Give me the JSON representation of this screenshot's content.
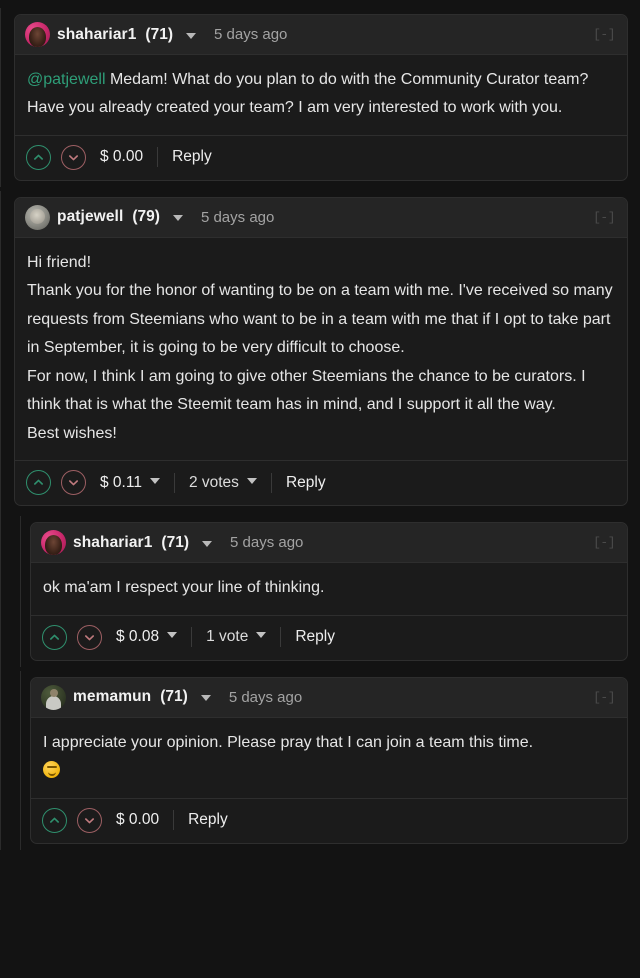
{
  "theme": {
    "page_background": "#131313",
    "card_background": "#1b1b1b",
    "header_background": "#252525",
    "border": "#2e2e2e",
    "upvote_color": "#2f8f6d",
    "downvote_color": "#9d5f63",
    "mention_color": "#2e9e78",
    "text_color": "#e6e6e6",
    "muted_text_color": "#a3a3a3"
  },
  "comments": [
    {
      "id": "comment-shahariar1-root",
      "level": 1,
      "avatar_style": "av-pink",
      "author": "shahariar1",
      "reputation": "(71)",
      "author_caret_icon": "chevron-down-icon",
      "timestamp": "5 days ago",
      "collapse_toggle": "[-]",
      "body_segments": [
        {
          "type": "mention",
          "text": "@patjewell"
        },
        {
          "type": "text",
          "text": " Medam! What do you plan to do with the Community Curator team? Have you already created your team? I am very interested to work with you."
        }
      ],
      "body_plain": "@patjewell Medam! What do you plan to do with the Community Curator team? Have you already created your team? I am very interested to work with you.",
      "upvote_icon": "chevron-up-icon",
      "downvote_icon": "chevron-down-icon",
      "payout": "$ 0.00",
      "payout_currency": "$",
      "payout_amount": "0.00",
      "payout_has_caret": false,
      "votes_label": "",
      "votes_visible": false,
      "reply_label": "Reply"
    },
    {
      "id": "comment-patjewell",
      "level": 1,
      "avatar_style": "av-gray",
      "author": "patjewell",
      "reputation": "(79)",
      "author_caret_icon": "chevron-down-icon",
      "timestamp": "5 days ago",
      "collapse_toggle": "[-]",
      "body_lines": [
        "Hi friend!",
        "Thank you for the honor of wanting to be on a team with me. I've received so many requests from Steemians who want to be in a team with me that if I opt to take part in September, it is going to be very difficult to choose.",
        "For now, I think I am going to give other Steemians the chance to be curators. I think that is what the Steemit team has in mind, and I support it all the way.",
        "Best wishes!"
      ],
      "upvote_icon": "chevron-up-icon",
      "downvote_icon": "chevron-down-icon",
      "payout": "$ 0.11",
      "payout_currency": "$",
      "payout_amount": "0.11",
      "payout_has_caret": true,
      "votes_label": "2 votes",
      "votes_visible": true,
      "reply_label": "Reply"
    },
    {
      "id": "comment-shahariar1-reply",
      "level": 2,
      "avatar_style": "av-pink",
      "author": "shahariar1",
      "reputation": "(71)",
      "author_caret_icon": "chevron-down-icon",
      "timestamp": "5 days ago",
      "collapse_toggle": "[-]",
      "body_plain": "ok ma'am I respect your line of thinking.",
      "upvote_icon": "chevron-up-icon",
      "downvote_icon": "chevron-down-icon",
      "payout": "$ 0.08",
      "payout_currency": "$",
      "payout_amount": "0.08",
      "payout_has_caret": true,
      "votes_label": "1 vote",
      "votes_visible": true,
      "reply_label": "Reply"
    },
    {
      "id": "comment-memamun",
      "level": 2,
      "avatar_style": "av-green",
      "author": "memamun",
      "reputation": "(71)",
      "author_caret_icon": "chevron-down-icon",
      "timestamp": "5 days ago",
      "collapse_toggle": "[-]",
      "body_plain": "I appreciate your opinion. Please pray that I can join a team this time.",
      "body_emoji": "smiling-face-emoji",
      "upvote_icon": "chevron-up-icon",
      "downvote_icon": "chevron-down-icon",
      "payout": "$ 0.00",
      "payout_currency": "$",
      "payout_amount": "0.00",
      "payout_has_caret": false,
      "votes_label": "",
      "votes_visible": false,
      "reply_label": "Reply"
    }
  ]
}
